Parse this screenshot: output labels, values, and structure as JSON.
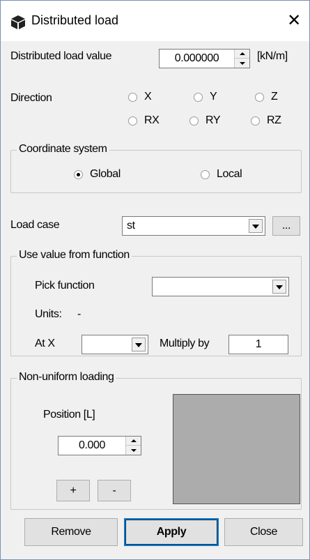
{
  "window": {
    "title": "Distributed load",
    "close_glyph": "✕",
    "icon": "cube-icon"
  },
  "load_value": {
    "label": "Distributed load value",
    "value": "0.000000",
    "unit": "[kN/m]"
  },
  "direction": {
    "label": "Direction",
    "options": [
      "X",
      "Y",
      "Z",
      "RX",
      "RY",
      "RZ"
    ]
  },
  "coordinate_system": {
    "title": "Coordinate system",
    "options": [
      "Global",
      "Local"
    ],
    "selected": "Global"
  },
  "load_case": {
    "label": "Load case",
    "value": "st",
    "browse_label": "..."
  },
  "function_group": {
    "title": "Use value from function",
    "pick_label": "Pick function",
    "pick_value": "",
    "units_label": "Units:",
    "units_value": "-",
    "at_x_label": "At X",
    "at_x_value": "",
    "multiply_label": "Multiply by",
    "multiply_value": "1"
  },
  "non_uniform": {
    "title": "Non-uniform loading",
    "position_label": "Position [L]",
    "position_value": "0.000",
    "add_label": "+",
    "remove_label": "-",
    "preview_color": "#acacac"
  },
  "buttons": {
    "remove": "Remove",
    "apply": "Apply",
    "close": "Close"
  }
}
